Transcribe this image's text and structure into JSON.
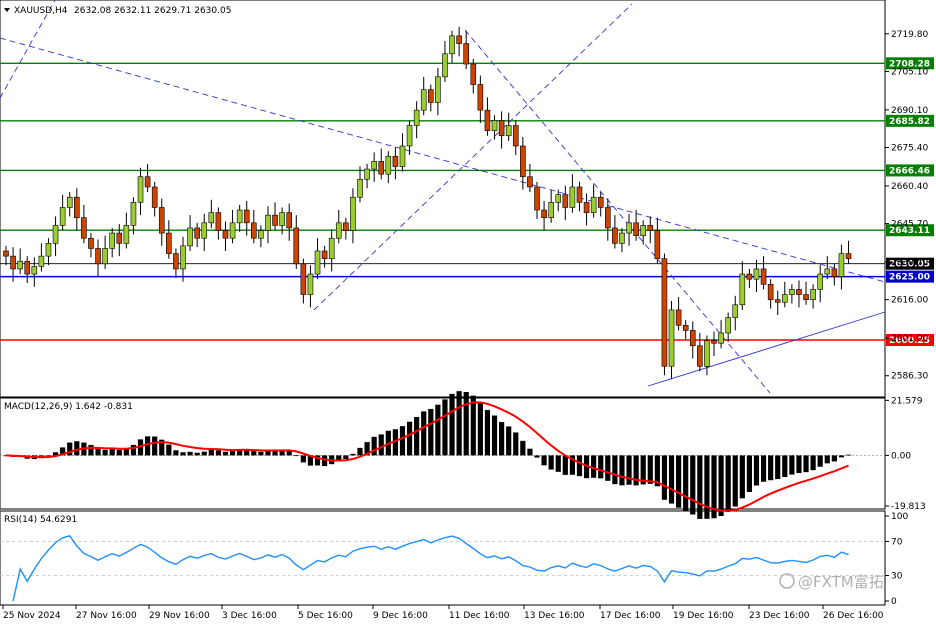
{
  "header": {
    "symbol": "XAUUSD,H4",
    "ohlc": "2632.08 2632.11 2629.71 2630.05"
  },
  "watermark": "@FXTM富拓",
  "colors": {
    "bull": "#9acd32",
    "bear": "#cc4400",
    "green_level": "#008000",
    "blue_level": "#0000cc",
    "red_level": "#ff0000",
    "trend": "#3333cc",
    "macd_hist": "#000000",
    "macd_signal": "#ff0000",
    "rsi": "#1e90ff",
    "grid": "#c0c0c0"
  },
  "chart_data": [
    {
      "type": "candlestick",
      "panel": "price",
      "symbol": "XAUUSD",
      "timeframe": "H4",
      "last_ohlc": {
        "open": 2632.08,
        "high": 2632.11,
        "low": 2629.71,
        "close": 2630.05
      },
      "ylim": [
        2578,
        2733
      ],
      "y_ticks": [
        "2719.80",
        "2705.10",
        "2690.10",
        "2675.40",
        "2660.40",
        "2645.70",
        "2630.70",
        "2616.00",
        "2601.00",
        "2586.30"
      ],
      "x_ticks": [
        "25 Nov 2024",
        "27 Nov 16:00",
        "29 Nov 16:00",
        "3 Dec 16:00",
        "5 Dec 16:00",
        "9 Dec 16:00",
        "11 Dec 16:00",
        "13 Dec 16:00",
        "17 Dec 16:00",
        "19 Dec 16:00",
        "23 Dec 16:00",
        "26 Dec 16:00"
      ],
      "horizontal_levels": [
        {
          "value": 2708.28,
          "label": "2708.28",
          "color": "green"
        },
        {
          "value": 2685.82,
          "label": "2685.82",
          "color": "green"
        },
        {
          "value": 2666.46,
          "label": "2666.46",
          "color": "green"
        },
        {
          "value": 2643.11,
          "label": "2643.11",
          "color": "green"
        },
        {
          "value": 2630.05,
          "label": "2630.05",
          "color": "black"
        },
        {
          "value": 2625.0,
          "label": "2625.00",
          "color": "blue"
        },
        {
          "value": 2600.25,
          "label": "2600.25",
          "color": "red"
        }
      ],
      "closes": [
        2633,
        2628,
        2631,
        2626,
        2629,
        2633,
        2638,
        2645,
        2652,
        2656,
        2648,
        2640,
        2636,
        2630,
        2636,
        2642,
        2638,
        2645,
        2654,
        2664,
        2660,
        2652,
        2642,
        2634,
        2628,
        2637,
        2644,
        2640,
        2646,
        2650,
        2643,
        2640,
        2646,
        2651,
        2646,
        2640,
        2643,
        2649,
        2645,
        2650,
        2644,
        2630,
        2618,
        2626,
        2635,
        2632,
        2640,
        2646,
        2643,
        2656,
        2663,
        2667,
        2670,
        2665,
        2672,
        2668,
        2676,
        2684,
        2690,
        2698,
        2693,
        2703,
        2712,
        2719,
        2716,
        2708,
        2700,
        2690,
        2682,
        2686,
        2680,
        2684,
        2676,
        2664,
        2660,
        2651,
        2648,
        2654,
        2657,
        2652,
        2660,
        2654,
        2650,
        2656,
        2652,
        2644,
        2638,
        2642,
        2646,
        2641,
        2645,
        2643,
        2632,
        2590,
        2612,
        2606,
        2604,
        2598,
        2590,
        2600,
        2599,
        2603,
        2609,
        2614,
        2626,
        2624,
        2628,
        2622,
        2616,
        2615,
        2618,
        2620,
        2618,
        2616,
        2620,
        2626,
        2628,
        2625,
        2634,
        2632
      ]
    },
    {
      "type": "macd",
      "panel": "macd",
      "label": "MACD(12,26,9) 1.642 -0.831",
      "params": [
        12,
        26,
        9
      ],
      "main": 1.642,
      "signal": -0.831,
      "ylim": [
        -21.0,
        22.5
      ],
      "y_ticks": [
        "21.579",
        "0.00",
        "-19.813"
      ]
    },
    {
      "type": "line",
      "panel": "rsi",
      "label": "RSI(14) 54.6291",
      "period": 14,
      "value": 54.6291,
      "ylim": [
        0,
        100
      ],
      "y_ticks": [
        "100",
        "70",
        "30",
        "0"
      ]
    }
  ]
}
